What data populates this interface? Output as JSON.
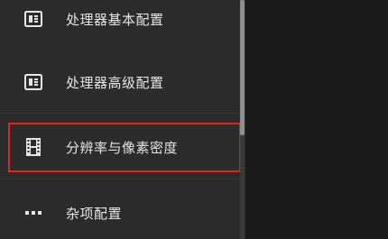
{
  "menu": {
    "items": [
      {
        "label": "处理器基本配置",
        "icon": "chip-icon"
      },
      {
        "label": "处理器高级配置",
        "icon": "chip-icon"
      },
      {
        "label": "分辨率与像素密度",
        "icon": "film-icon"
      },
      {
        "label": "杂项配置",
        "icon": "more-dots-icon"
      }
    ]
  },
  "colors": {
    "panel": "#2b2b2b",
    "background": "#1b1b1b",
    "text": "#e6e6e6",
    "highlight": "#e52222"
  }
}
